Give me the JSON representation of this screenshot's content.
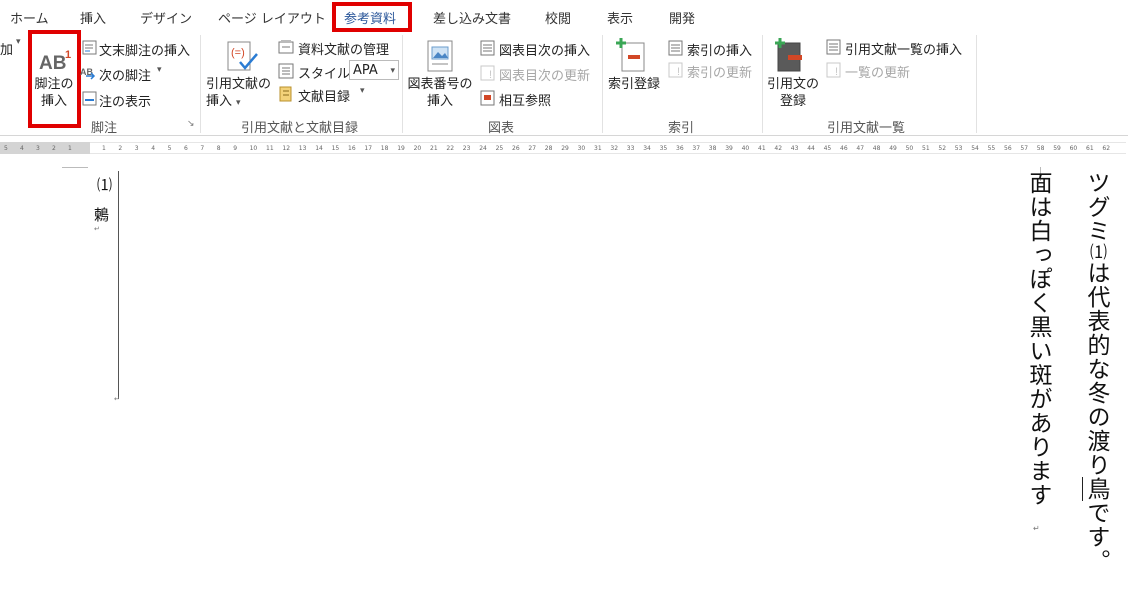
{
  "tabs": [
    "ホーム",
    "挿入",
    "デザイン",
    "ページ レイアウト",
    "参考資料",
    "差し込み文書",
    "校閲",
    "表示",
    "開発"
  ],
  "active_tab": "参考資料",
  "ribbon": {
    "cut_left_label": "加",
    "footnotes": {
      "insert_footnote": "脚注の",
      "insert_footnote2": "挿入",
      "insert_endnote": "文末脚注の挿入",
      "next_footnote": "次の脚注",
      "show_notes": "注の表示",
      "group_label": "脚注"
    },
    "citations": {
      "insert_citation": "引用文献の",
      "insert_citation2": "挿入",
      "manage_sources": "資料文献の管理",
      "style_label": "スタイル:",
      "style_value": "APA",
      "bibliography": "文献目録",
      "group_label": "引用文献と文献目録"
    },
    "captions": {
      "insert_caption": "図表番号の",
      "insert_caption2": "挿入",
      "insert_table_of_figures": "図表目次の挿入",
      "update_table": "図表目次の更新",
      "cross_reference": "相互参照",
      "group_label": "図表"
    },
    "index": {
      "mark_entry": "索引登録",
      "insert_index": "索引の挿入",
      "update_index": "索引の更新",
      "group_label": "索引"
    },
    "toa": {
      "mark_citation": "引用文の",
      "mark_citation2": "登録",
      "insert_toa": "引用文献一覧の挿入",
      "update_toa": "一覧の更新",
      "group_label": "引用文献一覧"
    }
  },
  "ruler_numbers": [
    "5",
    "4",
    "3",
    "2",
    "1",
    "1",
    "2",
    "3",
    "4",
    "5",
    "6",
    "7",
    "8",
    "9",
    "10",
    "11",
    "12",
    "13",
    "14",
    "15",
    "16",
    "17",
    "18",
    "19",
    "20",
    "21",
    "22",
    "23",
    "24",
    "25",
    "26",
    "27",
    "28",
    "29",
    "30",
    "31",
    "32",
    "33",
    "34",
    "35",
    "36",
    "37",
    "38",
    "39",
    "40",
    "41",
    "42",
    "43",
    "44",
    "45",
    "46",
    "47",
    "48",
    "49",
    "50",
    "51",
    "52",
    "53",
    "54",
    "55",
    "56",
    "57",
    "58",
    "59",
    "60",
    "61",
    "62"
  ],
  "document": {
    "line1_a": "ツグミ",
    "footnote_ref": "⑴",
    "line1_b": "は代表的な冬の渡り",
    "line1_c": "鳥",
    "line1_d": "です。",
    "line2": "面は白っぽく黒い斑があります",
    "footnote_number": "⑴",
    "footnote_text": "鶫"
  },
  "colors": {
    "highlight": "#e00000",
    "active_tab": "#2b579a"
  }
}
